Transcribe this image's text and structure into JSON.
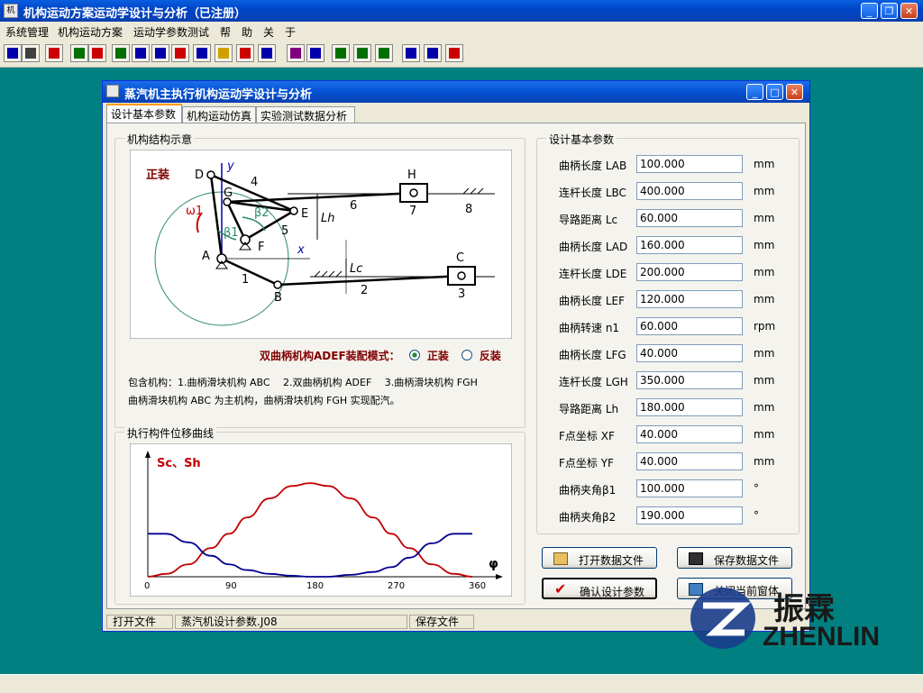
{
  "app": {
    "title": "机构运动方案运动学设计与分析（已注册）",
    "icon_label": "机",
    "window_controls": [
      "minimize-icon",
      "restore-icon",
      "close-icon"
    ]
  },
  "menu": [
    "系统管理",
    "机构运动方案",
    "运动学参数测试",
    "帮　助",
    "关　于"
  ],
  "toolbar": {
    "icons": [
      "grid-icon",
      "print-icon",
      "delete-icon",
      "chart-icon",
      "chart2-icon",
      "chart3-icon",
      "layout-icon",
      "layout2-icon",
      "mechanism-icon",
      "mechanism2-icon",
      "camera-icon",
      "mechanism3-icon",
      "mechanism4-icon",
      "book-icon",
      "monitor-icon",
      "edit-icon",
      "screen-icon",
      "screen2-icon",
      "computer-icon",
      "calc-icon",
      "folder-icon"
    ],
    "colors": {
      "red": "#cc0000",
      "green": "#007000",
      "blue": "#0000aa",
      "yellow": "#d0a000"
    }
  },
  "child": {
    "title": "蒸汽机主执行机构运动学设计与分析",
    "tabs": [
      "设计基本参数",
      "机构运动仿真",
      "实验测试数据分析"
    ],
    "structure_group_title": "机构结构示意",
    "diagram": {
      "mode_text": "正装",
      "points": {
        "A": "A",
        "B": "B",
        "C": "C",
        "D": "D",
        "E": "E",
        "F": "F",
        "G": "G",
        "H": "H"
      },
      "numbers": [
        "1",
        "2",
        "3",
        "4",
        "5",
        "6",
        "7",
        "8"
      ],
      "omega": "ω1",
      "beta1": "β1",
      "beta2": "β2",
      "axis_x": "x",
      "axis_y": "y",
      "lh": "Lh",
      "lc": "Lc"
    },
    "assembly_mode_label": "双曲柄机构ADEF装配模式：",
    "assembly_options": [
      "正装",
      "反装"
    ],
    "assembly_selected": "正装",
    "description_line1": "包含机构：1.曲柄滑块机构 ABC　 2.双曲柄机构 ADEF　 3.曲柄滑块机构 FGH",
    "description_line2": "曲柄滑块机构 ABC 为主机构，曲柄滑块机构 FGH 实现配汽。",
    "curve_group_title": "执行构件位移曲线",
    "params_group_title": "设计基本参数",
    "params": [
      {
        "label": "曲柄长度 LAB",
        "value": "100.000",
        "unit": "mm"
      },
      {
        "label": "连杆长度 LBC",
        "value": "400.000",
        "unit": "mm"
      },
      {
        "label": "导路距离 Lc",
        "value": "60.000",
        "unit": "mm"
      },
      {
        "label": "曲柄长度 LAD",
        "value": "160.000",
        "unit": "mm"
      },
      {
        "label": "连杆长度 LDE",
        "value": "200.000",
        "unit": "mm"
      },
      {
        "label": "曲柄长度 LEF",
        "value": "120.000",
        "unit": "mm"
      },
      {
        "label": "曲柄转速 n1",
        "value": "60.000",
        "unit": "rpm"
      },
      {
        "label": "曲柄长度 LFG",
        "value": "40.000",
        "unit": "mm"
      },
      {
        "label": "连杆长度 LGH",
        "value": "350.000",
        "unit": "mm"
      },
      {
        "label": "导路距离 Lh",
        "value": "180.000",
        "unit": "mm"
      },
      {
        "label": "F点坐标 XF",
        "value": "40.000",
        "unit": "mm"
      },
      {
        "label": "F点坐标 YF",
        "value": "40.000",
        "unit": "mm"
      },
      {
        "label": "曲柄夹角β1",
        "value": "100.000",
        "unit": "°"
      },
      {
        "label": "曲柄夹角β2",
        "value": "190.000",
        "unit": "°"
      }
    ],
    "buttons": {
      "open": "打开数据文件",
      "save": "保存数据文件",
      "confirm": "确认设计参数",
      "close": "关闭当前窗体"
    },
    "status": [
      "打开文件",
      "蒸汽机设计参数.J08",
      "保存文件"
    ]
  },
  "watermark": {
    "cn": "振霖",
    "en": "ZHENLIN"
  },
  "chart_data": {
    "type": "line",
    "title": "",
    "ylabel": "Sc、Sh",
    "xlabel": "φ",
    "x_ticks": [
      0,
      90,
      180,
      270,
      360
    ],
    "xlim": [
      0,
      360
    ],
    "ylim": [
      0,
      1
    ],
    "colors": {
      "Sc": "#c00000",
      "Sh": "#000090"
    },
    "series": [
      {
        "name": "Sc",
        "x": [
          0,
          20,
          45,
          70,
          90,
          110,
          135,
          160,
          180,
          200,
          225,
          250,
          270,
          290,
          315,
          340,
          360
        ],
        "y": [
          0.0,
          0.03,
          0.13,
          0.3,
          0.45,
          0.62,
          0.82,
          0.95,
          0.98,
          0.95,
          0.82,
          0.62,
          0.45,
          0.3,
          0.13,
          0.03,
          0.0
        ]
      },
      {
        "name": "Sh",
        "x": [
          0,
          20,
          45,
          70,
          90,
          110,
          135,
          160,
          180,
          200,
          225,
          250,
          270,
          290,
          315,
          340,
          360
        ],
        "y": [
          0.45,
          0.45,
          0.36,
          0.22,
          0.13,
          0.07,
          0.03,
          0.01,
          0.0,
          0.0,
          0.02,
          0.05,
          0.1,
          0.2,
          0.35,
          0.45,
          0.45
        ]
      }
    ]
  }
}
